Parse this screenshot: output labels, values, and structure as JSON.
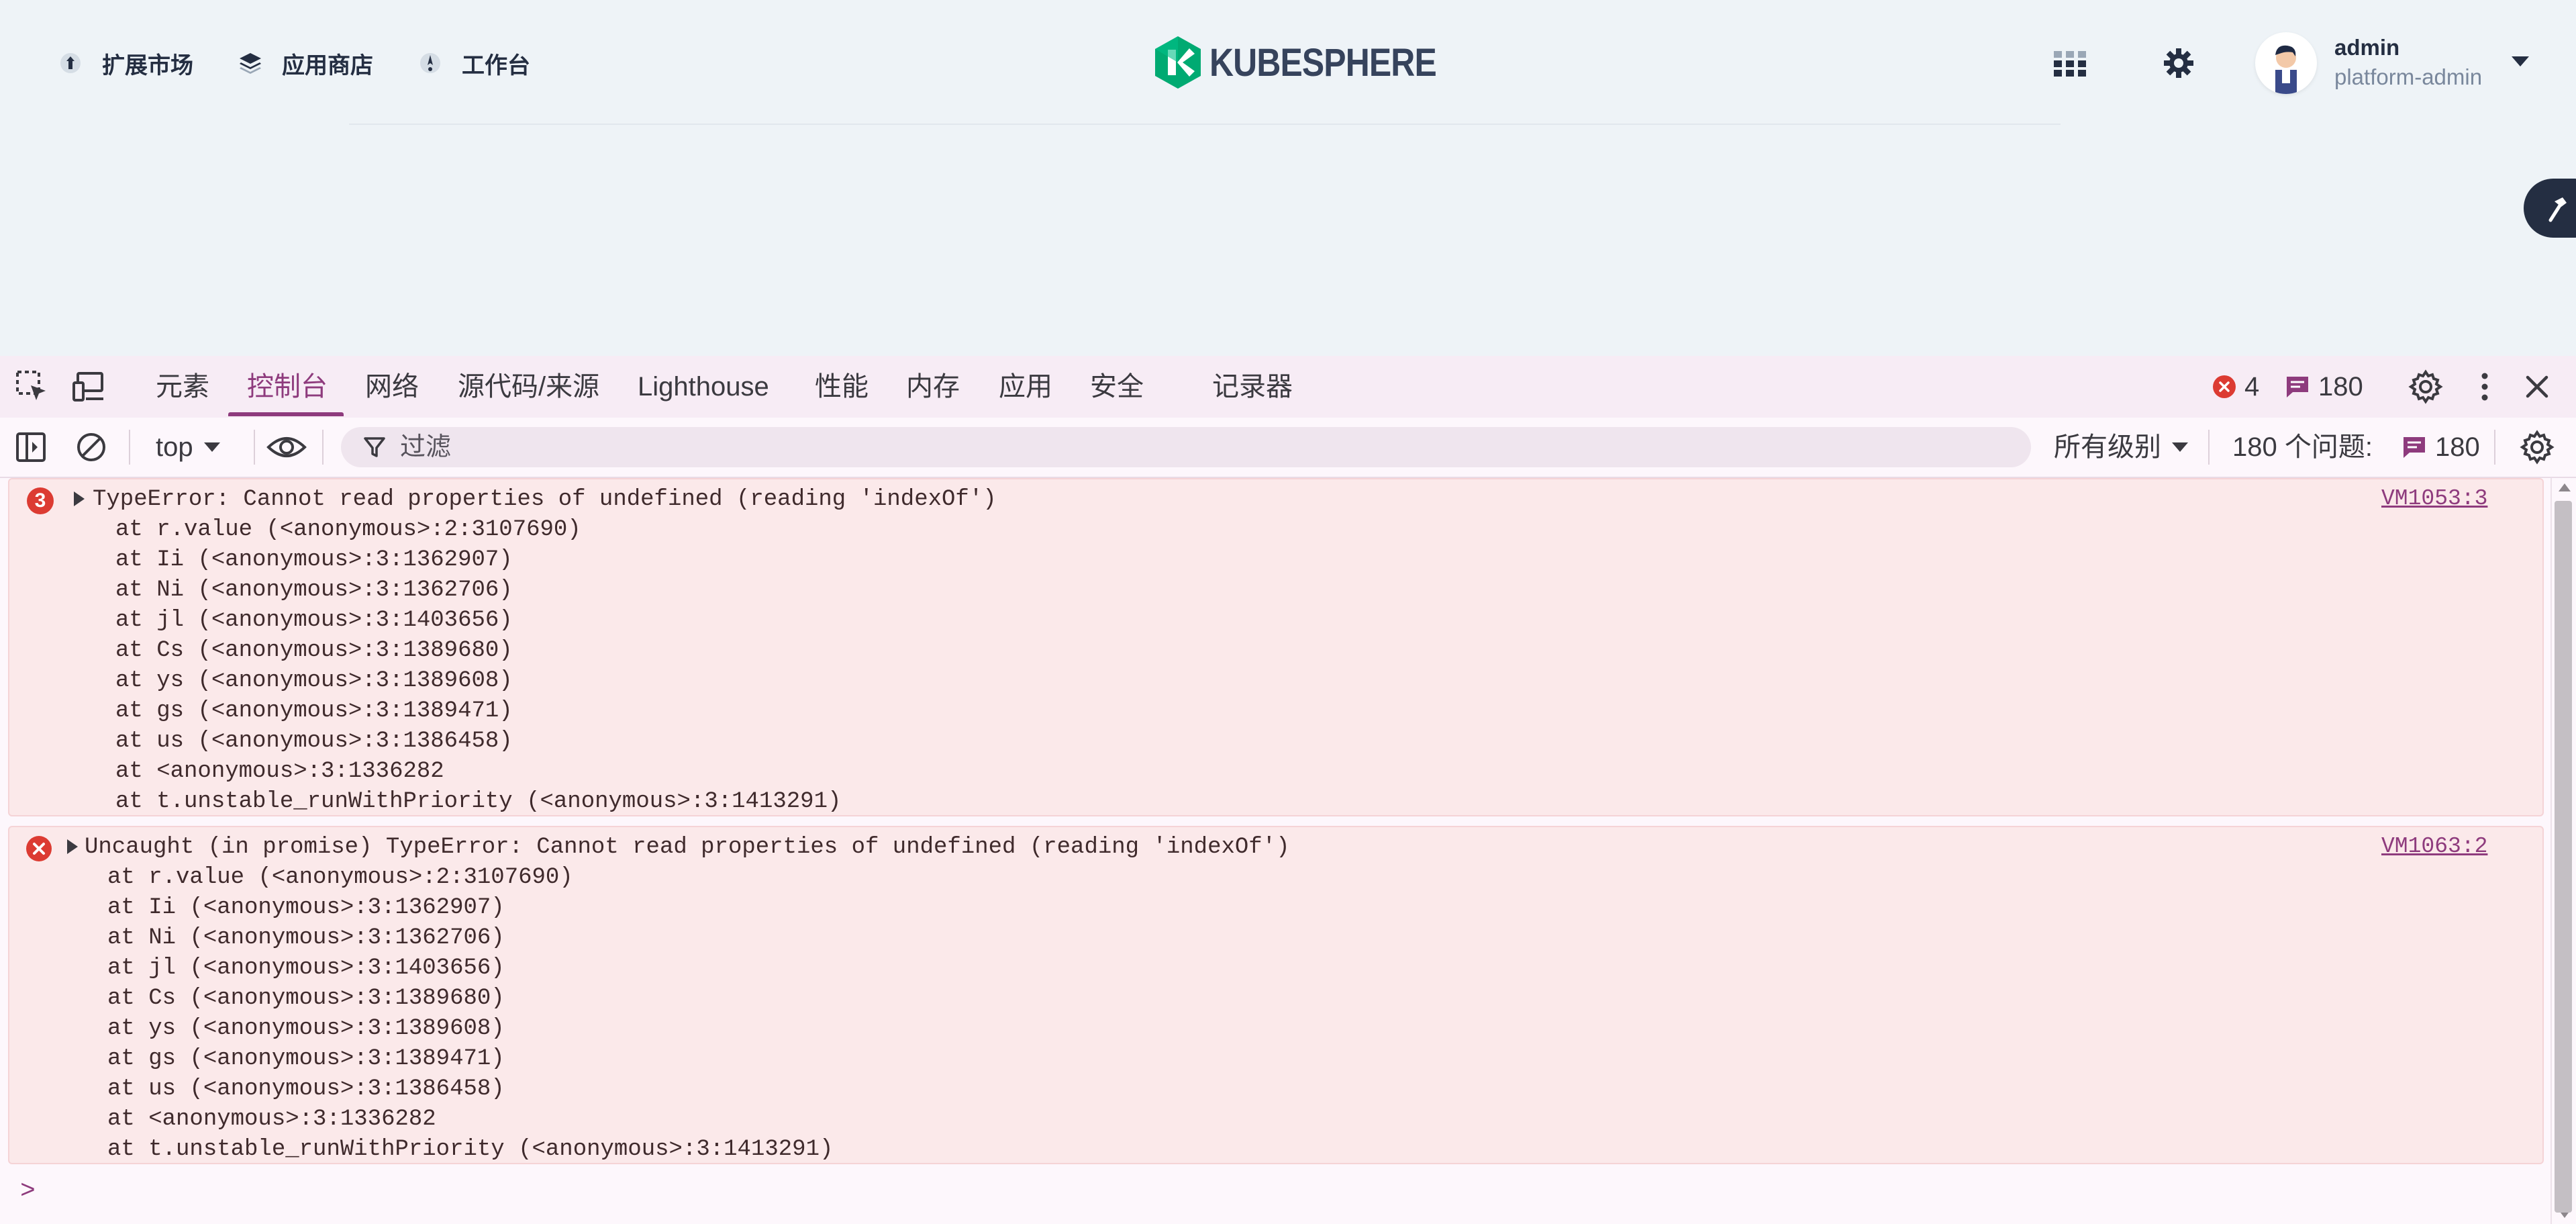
{
  "header": {
    "nav": [
      {
        "label": "扩展市场",
        "icon": "extension-icon"
      },
      {
        "label": "应用商店",
        "icon": "app-store-icon"
      },
      {
        "label": "工作台",
        "icon": "workbench-icon"
      }
    ],
    "logo_text": "KUBESPHERE",
    "user": {
      "name": "admin",
      "role": "platform-admin"
    },
    "icons": {
      "apps": "apps-grid-icon",
      "settings": "gear-icon",
      "tool": "hammer-icon"
    }
  },
  "devtools": {
    "tabs": [
      {
        "label": "元素"
      },
      {
        "label": "控制台",
        "active": true
      },
      {
        "label": "网络"
      },
      {
        "label": "源代码/来源"
      },
      {
        "label": "Lighthouse"
      },
      {
        "label": "性能"
      },
      {
        "label": "内存"
      },
      {
        "label": "应用"
      },
      {
        "label": "安全"
      },
      {
        "label": "记录器"
      }
    ],
    "error_count": "4",
    "message_count": "180",
    "toolbar": {
      "context": "top",
      "filter_placeholder": "过滤",
      "level": "所有级别",
      "issues_label": "180 个问题:",
      "issues_count": "180"
    }
  },
  "console": {
    "messages": [
      {
        "repeat": "3",
        "text": "TypeError: Cannot read properties of undefined (reading 'indexOf')",
        "source": "VM1053:3",
        "stack": [
          "at r.value (<anonymous>:2:3107690)",
          "at Ii (<anonymous>:3:1362907)",
          "at Ni (<anonymous>:3:1362706)",
          "at jl (<anonymous>:3:1403656)",
          "at Cs (<anonymous>:3:1389680)",
          "at ys (<anonymous>:3:1389608)",
          "at gs (<anonymous>:3:1389471)",
          "at us (<anonymous>:3:1386458)",
          "at <anonymous>:3:1336282",
          "at t.unstable_runWithPriority (<anonymous>:3:1413291)"
        ]
      },
      {
        "repeat": "",
        "text": "Uncaught (in promise) TypeError: Cannot read properties of undefined (reading 'indexOf')",
        "source": "VM1063:2",
        "stack": [
          "at r.value (<anonymous>:2:3107690)",
          "at Ii (<anonymous>:3:1362907)",
          "at Ni (<anonymous>:3:1362706)",
          "at jl (<anonymous>:3:1403656)",
          "at Cs (<anonymous>:3:1389680)",
          "at ys (<anonymous>:3:1389608)",
          "at gs (<anonymous>:3:1389471)",
          "at us (<anonymous>:3:1386458)",
          "at <anonymous>:3:1336282",
          "at t.unstable_runWithPriority (<anonymous>:3:1413291)"
        ]
      }
    ],
    "prompt_symbol": ">"
  },
  "colors": {
    "accent": "#8e3b7d",
    "error_red": "#dc3b32",
    "kubesphere_green": "#00aa72",
    "error_bg": "#fbe9ea"
  }
}
